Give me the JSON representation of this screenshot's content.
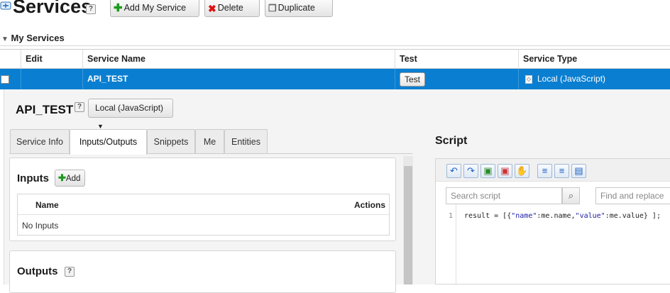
{
  "header": {
    "title": "Services",
    "help": "?",
    "buttons": [
      {
        "label": "Add My Service",
        "icon": "plus-icon"
      },
      {
        "label": "Delete",
        "icon": "x-icon"
      },
      {
        "label": "Duplicate",
        "icon": "duplicate-icon"
      }
    ]
  },
  "section": {
    "title": "My Services"
  },
  "grid": {
    "columns": [
      "Edit",
      "Service Name",
      "Test",
      "Service Type"
    ],
    "rows": [
      {
        "service_name": "API_TEST",
        "test_label": "Test",
        "service_type": "Local (JavaScript)"
      }
    ]
  },
  "detail": {
    "service_name": "API_TEST",
    "help": "?",
    "type_dropdown": "Local (JavaScript)",
    "tabs": [
      "Service Info",
      "Inputs/Outputs",
      "Snippets",
      "Me",
      "Entities"
    ],
    "active_tab": "Inputs/Outputs",
    "inputs": {
      "title": "Inputs",
      "add_label": "Add",
      "col_name": "Name",
      "col_actions": "Actions",
      "empty_text": "No Inputs"
    },
    "outputs": {
      "title": "Outputs",
      "help": "?"
    }
  },
  "script": {
    "title": "Script",
    "search_placeholder": "Search script",
    "replace_placeholder": "Find and replace",
    "line_number": "1",
    "code": {
      "p1": "result = [{",
      "s1": "\"name\"",
      "p2": ":me.name,",
      "s2": "\"value\"",
      "p3": ":me.value} ];"
    }
  },
  "colors": {
    "selected_row": "#0a7fd1",
    "string_token": "#1a1aa6"
  }
}
